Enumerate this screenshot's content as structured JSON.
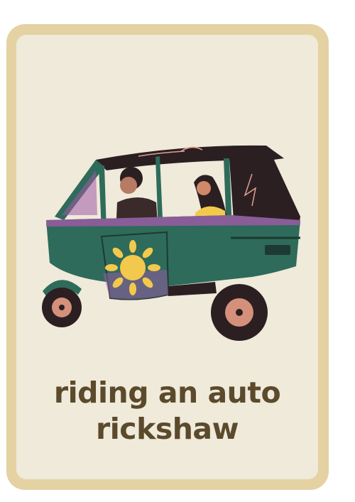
{
  "card": {
    "caption_line1": "riding an auto",
    "caption_line2": "rickshaw"
  },
  "illustration": {
    "subject": "auto-rickshaw with driver and passenger",
    "icons": [
      "auto-rickshaw-icon",
      "sun-motif-icon",
      "driver-figure",
      "passenger-figure"
    ]
  },
  "colors": {
    "card_border": "#e4d2a3",
    "card_background": "#efeada",
    "caption_text": "#5b4a2b",
    "rickshaw_body": "#2f6b5a",
    "rickshaw_roof": "#2b1f22",
    "accent_purple": "#a05aa8",
    "sun_yellow": "#f2c94c"
  }
}
